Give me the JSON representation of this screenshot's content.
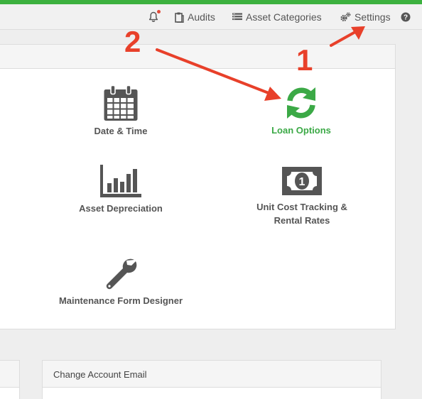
{
  "nav": {
    "audits": "Audits",
    "asset_categories": "Asset Categories",
    "settings": "Settings",
    "help": "?"
  },
  "tiles": {
    "date_time": "Date & Time",
    "loan_options": "Loan Options",
    "asset_depreciation": "Asset Depreciation",
    "unit_cost_line1": "Unit Cost Tracking &",
    "unit_cost_line2": "Rental Rates",
    "maintenance_form_designer": "Maintenance Form Designer"
  },
  "cards": {
    "change_account_email": "Change Account Email"
  },
  "annotations": {
    "step1": "1",
    "step2": "2"
  },
  "colors": {
    "accent_green": "#3cb13f",
    "loan_green": "#3ba946",
    "annotation_red": "#e8402a",
    "notification_dot": "#e04b3a"
  },
  "icons": {
    "bell": "bell-icon",
    "audits": "clipboard-icon",
    "categories": "list-icon",
    "settings": "gears-icon",
    "help": "question-circle-icon",
    "date_time": "calendar-icon",
    "loan_options": "refresh-icon",
    "asset_depreciation": "bar-chart-icon",
    "unit_cost": "money-bill-icon",
    "maintenance": "wrench-icon"
  }
}
